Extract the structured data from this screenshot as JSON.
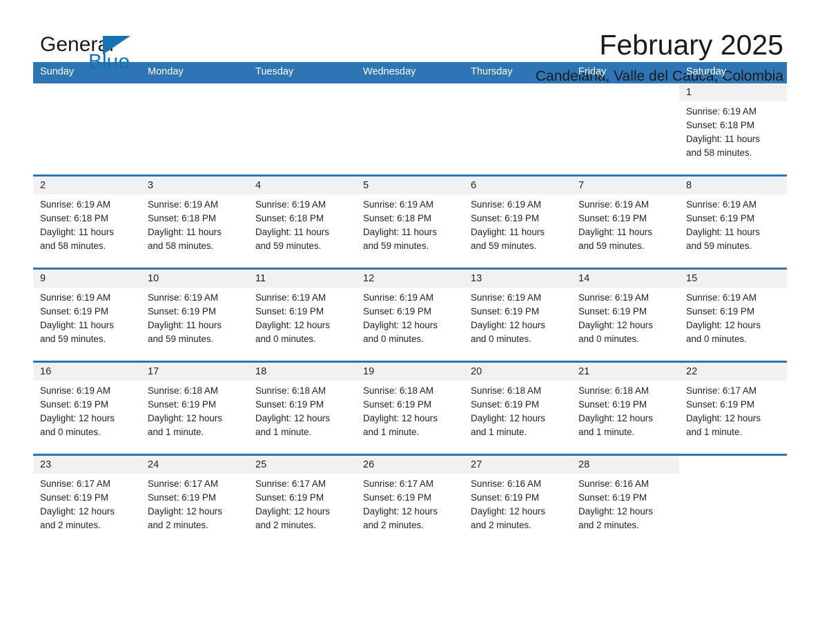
{
  "brand": {
    "name_part1": "General",
    "name_part2": "Blue",
    "accent_color": "#1273b5"
  },
  "header": {
    "title": "February 2025",
    "subtitle": "Candelaria, Valle del Cauca, Colombia"
  },
  "calendar": {
    "header_color": "#2e75b6",
    "weekdays": [
      "Sunday",
      "Monday",
      "Tuesday",
      "Wednesday",
      "Thursday",
      "Friday",
      "Saturday"
    ],
    "weeks": [
      [
        {
          "day": "",
          "blank": true
        },
        {
          "day": "",
          "blank": true
        },
        {
          "day": "",
          "blank": true
        },
        {
          "day": "",
          "blank": true
        },
        {
          "day": "",
          "blank": true
        },
        {
          "day": "",
          "blank": true
        },
        {
          "day": "1",
          "sunrise": "Sunrise: 6:19 AM",
          "sunset": "Sunset: 6:18 PM",
          "daylight_1": "Daylight: 11 hours",
          "daylight_2": "and 58 minutes."
        }
      ],
      [
        {
          "day": "2",
          "sunrise": "Sunrise: 6:19 AM",
          "sunset": "Sunset: 6:18 PM",
          "daylight_1": "Daylight: 11 hours",
          "daylight_2": "and 58 minutes."
        },
        {
          "day": "3",
          "sunrise": "Sunrise: 6:19 AM",
          "sunset": "Sunset: 6:18 PM",
          "daylight_1": "Daylight: 11 hours",
          "daylight_2": "and 58 minutes."
        },
        {
          "day": "4",
          "sunrise": "Sunrise: 6:19 AM",
          "sunset": "Sunset: 6:18 PM",
          "daylight_1": "Daylight: 11 hours",
          "daylight_2": "and 59 minutes."
        },
        {
          "day": "5",
          "sunrise": "Sunrise: 6:19 AM",
          "sunset": "Sunset: 6:18 PM",
          "daylight_1": "Daylight: 11 hours",
          "daylight_2": "and 59 minutes."
        },
        {
          "day": "6",
          "sunrise": "Sunrise: 6:19 AM",
          "sunset": "Sunset: 6:19 PM",
          "daylight_1": "Daylight: 11 hours",
          "daylight_2": "and 59 minutes."
        },
        {
          "day": "7",
          "sunrise": "Sunrise: 6:19 AM",
          "sunset": "Sunset: 6:19 PM",
          "daylight_1": "Daylight: 11 hours",
          "daylight_2": "and 59 minutes."
        },
        {
          "day": "8",
          "sunrise": "Sunrise: 6:19 AM",
          "sunset": "Sunset: 6:19 PM",
          "daylight_1": "Daylight: 11 hours",
          "daylight_2": "and 59 minutes."
        }
      ],
      [
        {
          "day": "9",
          "sunrise": "Sunrise: 6:19 AM",
          "sunset": "Sunset: 6:19 PM",
          "daylight_1": "Daylight: 11 hours",
          "daylight_2": "and 59 minutes."
        },
        {
          "day": "10",
          "sunrise": "Sunrise: 6:19 AM",
          "sunset": "Sunset: 6:19 PM",
          "daylight_1": "Daylight: 11 hours",
          "daylight_2": "and 59 minutes."
        },
        {
          "day": "11",
          "sunrise": "Sunrise: 6:19 AM",
          "sunset": "Sunset: 6:19 PM",
          "daylight_1": "Daylight: 12 hours",
          "daylight_2": "and 0 minutes."
        },
        {
          "day": "12",
          "sunrise": "Sunrise: 6:19 AM",
          "sunset": "Sunset: 6:19 PM",
          "daylight_1": "Daylight: 12 hours",
          "daylight_2": "and 0 minutes."
        },
        {
          "day": "13",
          "sunrise": "Sunrise: 6:19 AM",
          "sunset": "Sunset: 6:19 PM",
          "daylight_1": "Daylight: 12 hours",
          "daylight_2": "and 0 minutes."
        },
        {
          "day": "14",
          "sunrise": "Sunrise: 6:19 AM",
          "sunset": "Sunset: 6:19 PM",
          "daylight_1": "Daylight: 12 hours",
          "daylight_2": "and 0 minutes."
        },
        {
          "day": "15",
          "sunrise": "Sunrise: 6:19 AM",
          "sunset": "Sunset: 6:19 PM",
          "daylight_1": "Daylight: 12 hours",
          "daylight_2": "and 0 minutes."
        }
      ],
      [
        {
          "day": "16",
          "sunrise": "Sunrise: 6:19 AM",
          "sunset": "Sunset: 6:19 PM",
          "daylight_1": "Daylight: 12 hours",
          "daylight_2": "and 0 minutes."
        },
        {
          "day": "17",
          "sunrise": "Sunrise: 6:18 AM",
          "sunset": "Sunset: 6:19 PM",
          "daylight_1": "Daylight: 12 hours",
          "daylight_2": "and 1 minute."
        },
        {
          "day": "18",
          "sunrise": "Sunrise: 6:18 AM",
          "sunset": "Sunset: 6:19 PM",
          "daylight_1": "Daylight: 12 hours",
          "daylight_2": "and 1 minute."
        },
        {
          "day": "19",
          "sunrise": "Sunrise: 6:18 AM",
          "sunset": "Sunset: 6:19 PM",
          "daylight_1": "Daylight: 12 hours",
          "daylight_2": "and 1 minute."
        },
        {
          "day": "20",
          "sunrise": "Sunrise: 6:18 AM",
          "sunset": "Sunset: 6:19 PM",
          "daylight_1": "Daylight: 12 hours",
          "daylight_2": "and 1 minute."
        },
        {
          "day": "21",
          "sunrise": "Sunrise: 6:18 AM",
          "sunset": "Sunset: 6:19 PM",
          "daylight_1": "Daylight: 12 hours",
          "daylight_2": "and 1 minute."
        },
        {
          "day": "22",
          "sunrise": "Sunrise: 6:17 AM",
          "sunset": "Sunset: 6:19 PM",
          "daylight_1": "Daylight: 12 hours",
          "daylight_2": "and 1 minute."
        }
      ],
      [
        {
          "day": "23",
          "sunrise": "Sunrise: 6:17 AM",
          "sunset": "Sunset: 6:19 PM",
          "daylight_1": "Daylight: 12 hours",
          "daylight_2": "and 2 minutes."
        },
        {
          "day": "24",
          "sunrise": "Sunrise: 6:17 AM",
          "sunset": "Sunset: 6:19 PM",
          "daylight_1": "Daylight: 12 hours",
          "daylight_2": "and 2 minutes."
        },
        {
          "day": "25",
          "sunrise": "Sunrise: 6:17 AM",
          "sunset": "Sunset: 6:19 PM",
          "daylight_1": "Daylight: 12 hours",
          "daylight_2": "and 2 minutes."
        },
        {
          "day": "26",
          "sunrise": "Sunrise: 6:17 AM",
          "sunset": "Sunset: 6:19 PM",
          "daylight_1": "Daylight: 12 hours",
          "daylight_2": "and 2 minutes."
        },
        {
          "day": "27",
          "sunrise": "Sunrise: 6:16 AM",
          "sunset": "Sunset: 6:19 PM",
          "daylight_1": "Daylight: 12 hours",
          "daylight_2": "and 2 minutes."
        },
        {
          "day": "28",
          "sunrise": "Sunrise: 6:16 AM",
          "sunset": "Sunset: 6:19 PM",
          "daylight_1": "Daylight: 12 hours",
          "daylight_2": "and 2 minutes."
        },
        {
          "day": "",
          "blank": true
        }
      ]
    ]
  }
}
